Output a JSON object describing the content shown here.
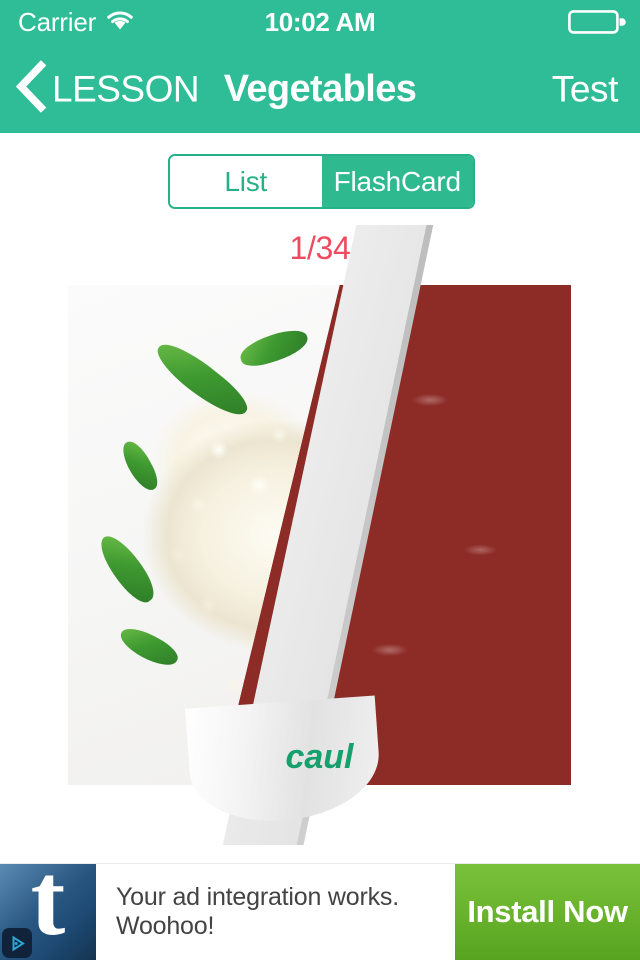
{
  "status_bar": {
    "carrier": "Carrier",
    "wifi_icon": "wifi-icon",
    "time": "10:02 AM",
    "battery_icon": "battery-icon"
  },
  "nav_bar": {
    "back_icon": "chevron-left-icon",
    "back_label": "LESSON",
    "title": "Vegetables",
    "right_action": "Test"
  },
  "segmented_control": {
    "options": [
      {
        "label": "List",
        "active": false
      },
      {
        "label": "FlashCard",
        "active": true
      }
    ]
  },
  "flashcard": {
    "counter": "1/34",
    "current_index": 1,
    "total": 34,
    "front_word": "cauliflower",
    "front_word_visible": "caul",
    "front_image_alt": "cauliflower",
    "back_image_alt": "kidney beans",
    "transition": "page-curl"
  },
  "ad_banner": {
    "logo_letter": "t",
    "adchoices_icon": "adchoices-icon",
    "text": "Your ad integration works. Woohoo!",
    "cta_label": "Install Now"
  },
  "colors": {
    "brand_green": "#2ebd96",
    "segment_border": "#28b089",
    "counter_red": "#ef4a5f",
    "word_green": "#16a06d",
    "ad_cta_green": "#6bb52e",
    "ad_logo_blue": "#2c5b86"
  }
}
